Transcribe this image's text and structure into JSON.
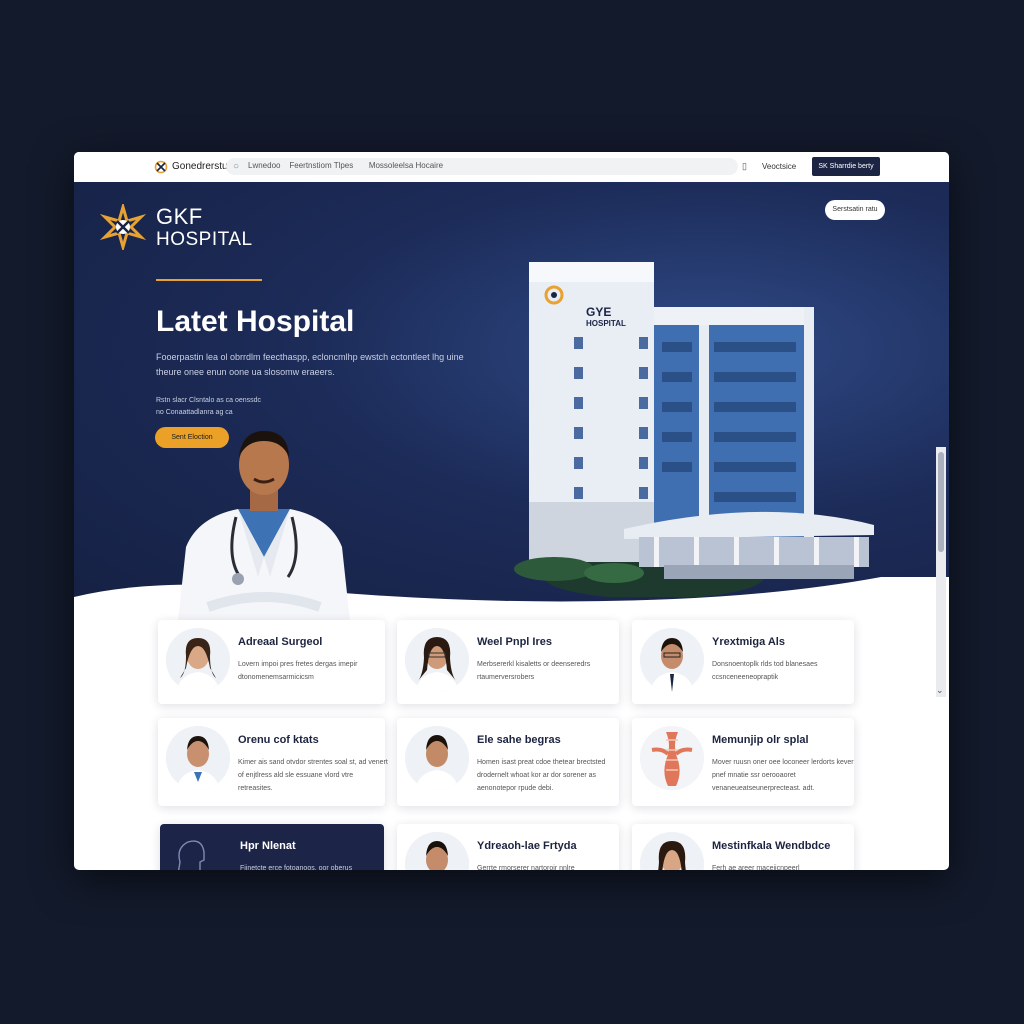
{
  "colors": {
    "navy": "#1c2443",
    "accent": "#eba128",
    "page_bg": "#131a2b"
  },
  "topbar": {
    "brand": "Gonedrerstu",
    "search_prefix": "Lwnedoo",
    "search_text_1": "Feertnstiom Tlpes",
    "search_text_2": "Mossoleelsa Hocaire",
    "link": "Veoctsice",
    "button": "SK Sharrdie berty"
  },
  "hero": {
    "brand_line1": "GKF",
    "brand_line2": "HOSPITAL",
    "title": "Latet Hospital",
    "description": "Fooerpastin lea ol obrrdlm feecthaspp, ecloncmlhp ewstch ectontleet lhg uine theure onee enun oone ua slosomw eraeers.",
    "meta_line1": "Rstn slacr Clsntalo as ca oenssdc",
    "meta_line2": "no Conaattadlanra ag ca",
    "cta": "Sent Eloction",
    "pill": "Serstsatin ratu",
    "building_sign_1": "GYE",
    "building_sign_2": "HOSPITAL"
  },
  "cards": [
    {
      "title": "Adreaal Surgeol",
      "desc": "Lovern impoi pres fretes dergas imepir dtonomenemsarmicicsm",
      "icon": "doctor-avatar-icon"
    },
    {
      "title": "Weel Pnpl Ires",
      "desc": "Merbsererkl kisaletts or deenseredrs rtaumerversrobers",
      "icon": "doctor-avatar-icon"
    },
    {
      "title": "Yrextmiga Als",
      "desc": "Donsnoentoplk rlds tod blanesaes ccsnceneeneopraptik",
      "icon": "doctor-avatar-icon"
    },
    {
      "title": "Orenu cof ktats",
      "desc": "Kimer ais sand otvdor strentes soal st, ad venert of enjtlress ald sle essuane vlord vtre retreasites.",
      "icon": "doctor-avatar-icon"
    },
    {
      "title": "Ele sahe begras",
      "desc": "Homen isast preat cdoe thetear brectsted drodernelt whoat kor ar dor sorener as aenonotepor rpude debi.",
      "icon": "doctor-avatar-icon"
    },
    {
      "title": "Memunjip olr splal",
      "desc": "Mover ruusn oner oee loconeer lerdorts kever pnef mnatie ssr oerooaoret venaneueatseunerprecteast. adt.",
      "icon": "spine-icon"
    },
    {
      "title": "Hpr Nlenat",
      "desc": "Fiinetcte erce fotoanoos, oor oberus",
      "icon": "head-outline-icon"
    },
    {
      "title": "Ydreaoh-lae Frtyda",
      "desc": "Gerrte rmorserer nartoroir nnlre",
      "icon": "doctor-avatar-icon"
    },
    {
      "title": "Mestinfkala Wendbdce",
      "desc": "Ferh ae areer maceiicnpeerl",
      "icon": "doctor-avatar-icon"
    }
  ]
}
